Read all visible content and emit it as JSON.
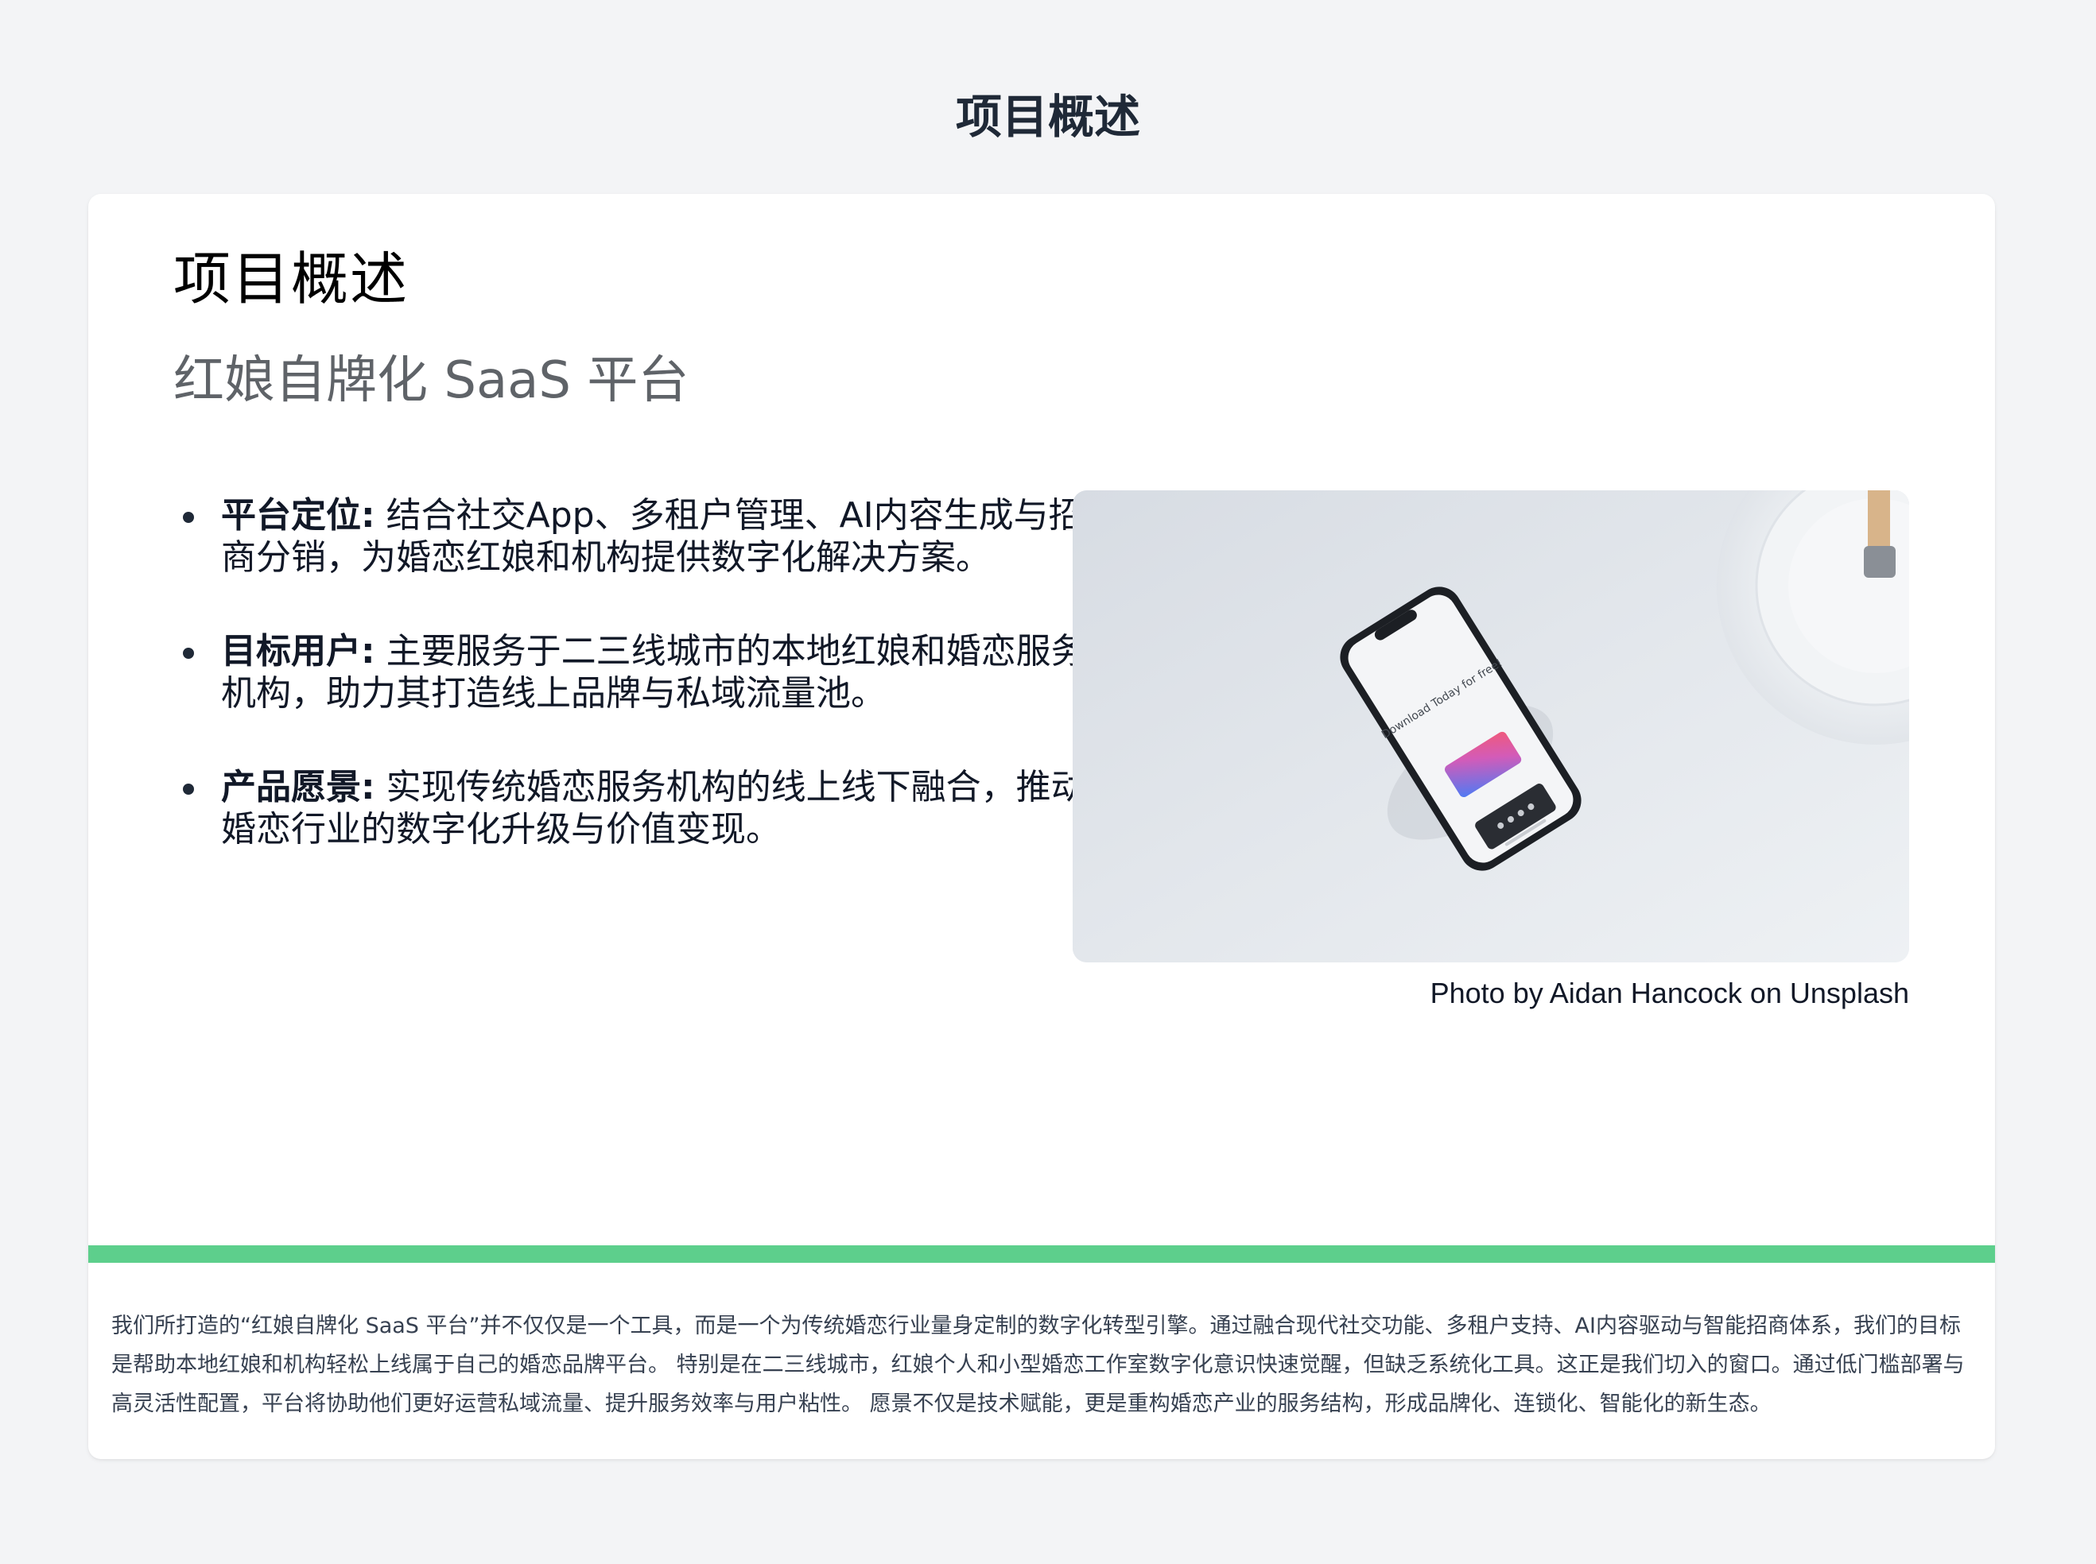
{
  "page": {
    "heading": "项目概述"
  },
  "slide": {
    "title": "项目概述",
    "subtitle": "红娘自牌化 SaaS 平台",
    "bullets": [
      {
        "label": "平台定位:",
        "text": "结合社交App、多租户管理、AI内容生成与招商分销，为婚恋红娘和机构提供数字化解决方案。"
      },
      {
        "label": "目标用户:",
        "text": "主要服务于二三线城市的本地红娘和婚恋服务机构，助力其打造线上品牌与私域流量池。"
      },
      {
        "label": "产品愿景:",
        "text": "实现传统婚恋服务机构的线上线下融合，推动婚恋行业的数字化升级与价值变现。"
      }
    ],
    "photo": {
      "screen_text": "Download Today for free!",
      "credit": "Photo by Aidan Hancock on Unsplash"
    }
  },
  "footer": {
    "text": "我们所打造的“红娘自牌化 SaaS 平台”并不仅仅是一个工具，而是一个为传统婚恋行业量身定制的数字化转型引擎。通过融合现代社交功能、多租户支持、AI内容驱动与智能招商体系，我们的目标是帮助本地红娘和机构轻松上线属于自己的婚恋品牌平台。 特别是在二三线城市，红娘个人和小型婚恋工作室数字化意识快速觉醒，但缺乏系统化工具。这正是我们切入的窗口。通过低门槛部署与高灵活性配置，平台将协助他们更好运营私域流量、提升服务效率与用户粘性。 愿景不仅是技术赋能，更是重构婚恋产业的服务结构，形成品牌化、连锁化、智能化的新生态。"
  },
  "colors": {
    "background": "#f3f4f6",
    "card": "#ffffff",
    "accent_bar": "#5dcf8c",
    "subtitle": "#5f6368"
  }
}
